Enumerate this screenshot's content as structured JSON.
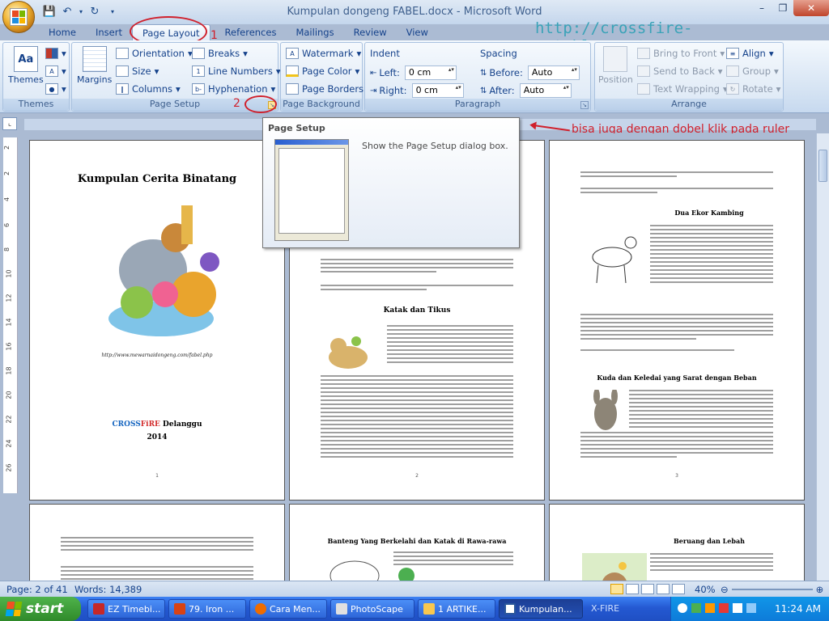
{
  "window": {
    "title": "Kumpulan dongeng FABEL.docx - Microsoft Word"
  },
  "qat": {
    "save": "save-icon",
    "undo": "undo-icon",
    "redo": "redo-icon"
  },
  "tabs": [
    "Home",
    "Insert",
    "Page Layout",
    "References",
    "Mailings",
    "Review",
    "View"
  ],
  "watermark_url": "http://crossfire-net.blogspot.com",
  "ribbon": {
    "themes": {
      "label": "Themes",
      "group": "Themes"
    },
    "page_setup": {
      "margins": "Margins",
      "orientation": "Orientation",
      "size": "Size",
      "columns": "Columns",
      "breaks": "Breaks",
      "line_numbers": "Line Numbers",
      "hyphenation": "Hyphenation",
      "group": "Page Setup"
    },
    "page_background": {
      "watermark": "Watermark",
      "page_color": "Page Color",
      "page_borders": "Page Borders",
      "group": "Page Background"
    },
    "paragraph": {
      "indent": "Indent",
      "left": "Left:",
      "left_val": "0 cm",
      "right": "Right:",
      "right_val": "0 cm",
      "spacing": "Spacing",
      "before": "Before:",
      "before_val": "Auto",
      "after": "After:",
      "after_val": "Auto",
      "group": "Paragraph"
    },
    "arrange": {
      "position": "Position",
      "bring_front": "Bring to Front",
      "send_back": "Send to Back",
      "text_wrapping": "Text Wrapping",
      "align": "Align",
      "group_btn": "Group",
      "rotate": "Rotate",
      "group": "Arrange"
    }
  },
  "annotations": {
    "one": "1",
    "two": "2",
    "ruler_note": "bisa juga dengan dobel klik pada ruler"
  },
  "tooltip": {
    "title": "Page Setup",
    "description": "Show the Page Setup dialog box."
  },
  "ruler_numbers": [
    "2",
    "2",
    "4",
    "6",
    "8",
    "10",
    "12",
    "14",
    "16",
    "18",
    "20",
    "22",
    "24",
    "26"
  ],
  "pages": {
    "p1": {
      "title": "Kumpulan Cerita Binatang",
      "url": "http://www.mewarnaidongeng.com/fabel.php",
      "author_a": "CROSS",
      "author_b": "FiRE",
      "author_c": " Delanggu",
      "year": "2014",
      "num": "1"
    },
    "p2": {
      "story": "Katak dan Tikus",
      "num": "2"
    },
    "p3": {
      "story1": "Dua Ekor Kambing",
      "story2": "Kuda dan Keledai yang Sarat dengan Beban",
      "num": "3"
    },
    "p5": {
      "story": "Banteng Yang Berkelahi dan Katak di Rawa-rawa"
    },
    "p6": {
      "story": "Beruang dan Lebah"
    }
  },
  "status": {
    "page": "Page: 2 of 41",
    "words": "Words: 14,389",
    "zoom": "40%"
  },
  "taskbar": {
    "start": "start",
    "items": [
      "EZ Timebi...",
      "79. Iron ...",
      "Cara Men...",
      "PhotoScape",
      "1 ARTIKE...",
      "Kumpulan...",
      "X-FIRE"
    ],
    "clock": "11:24 AM"
  },
  "colors": {
    "accent": "#15428b",
    "annotation": "#d0202c",
    "url": "#3aa3b8"
  }
}
